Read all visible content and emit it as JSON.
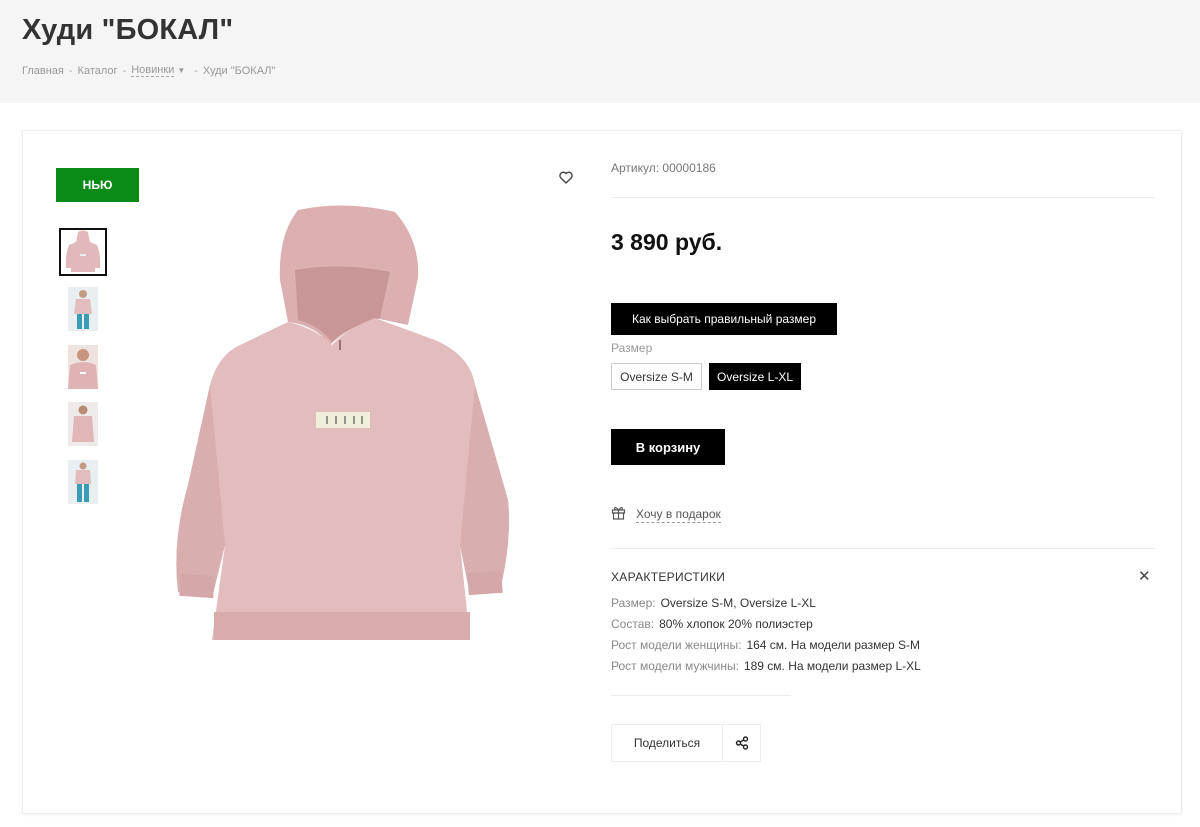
{
  "header": {
    "title": "Худи \"БОКАЛ\"",
    "breadcrumb": [
      {
        "label": "Главная"
      },
      {
        "label": "Каталог"
      },
      {
        "label": "Новинки"
      },
      {
        "label": "Худи \"БОКАЛ\""
      }
    ]
  },
  "product": {
    "badge": "НЬЮ",
    "sku": "Артикул: 00000186",
    "price": "3 890 руб.",
    "size_guide_button": "Как выбрать правильный размер",
    "size_label": "Размер",
    "sizes": [
      {
        "label": "Oversize S-M",
        "selected": false
      },
      {
        "label": "Oversize L-XL",
        "selected": true
      }
    ],
    "cart_button": "В корзину",
    "gift_link": "Хочу в подарок",
    "gallery": {
      "thumbnails": [
        "hoodie-flat",
        "model-woman-front",
        "model-woman-closeup",
        "model-woman-side",
        "model-woman-full"
      ],
      "active_index": 0,
      "product_color": "#e3bcbd"
    }
  },
  "specs": {
    "title": "ХАРАКТЕРИСТИКИ",
    "close_icon": "close-icon",
    "rows": [
      {
        "key": "Размер:",
        "value": "Oversize S-M, Oversize L-XL"
      },
      {
        "key": "Состав:",
        "value": "80% хлопок 20% полиэстер"
      },
      {
        "key": "Рост модели женщины:",
        "value": "164 см. На модели размер S-M"
      },
      {
        "key": "Рост модели мужчины:",
        "value": "189 см. На модели размер L-XL"
      }
    ]
  },
  "share": {
    "label": "Поделиться",
    "icon": "share-icon"
  },
  "colors": {
    "badge": "#0a8a16",
    "buttons": "#000000",
    "header_bg": "#f5f5f5"
  }
}
